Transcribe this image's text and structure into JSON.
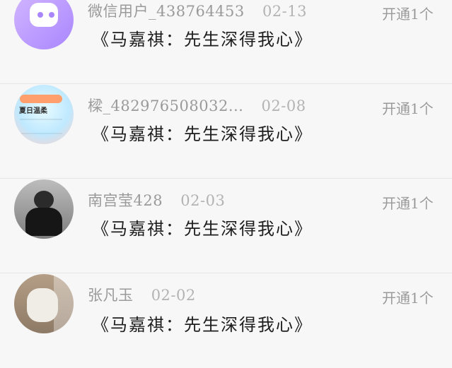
{
  "items": [
    {
      "username": "微信用户_438764453",
      "date": "02-13",
      "message": "《马嘉祺：先生深得我心》",
      "status": "开通1个",
      "avatar": "purple-smile"
    },
    {
      "username": "樑_482976508032...",
      "date": "02-08",
      "message": "《马嘉祺：先生深得我心》",
      "status": "开通1个",
      "avatar": "summer-app",
      "avatar_text": "夏日温柔"
    },
    {
      "username": "南宫莹428",
      "date": "02-03",
      "message": "《马嘉祺：先生深得我心》",
      "status": "开通1个",
      "avatar": "person-photo"
    },
    {
      "username": "张凡玉",
      "date": "02-02",
      "message": "《马嘉祺：先生深得我心》",
      "status": "开通1个",
      "avatar": "child-photo"
    }
  ],
  "colors": {
    "background": "#f7f7f7",
    "meta": "#9a9a9a",
    "message": "#1e1e1e",
    "accent_purple": "#a986ff"
  }
}
